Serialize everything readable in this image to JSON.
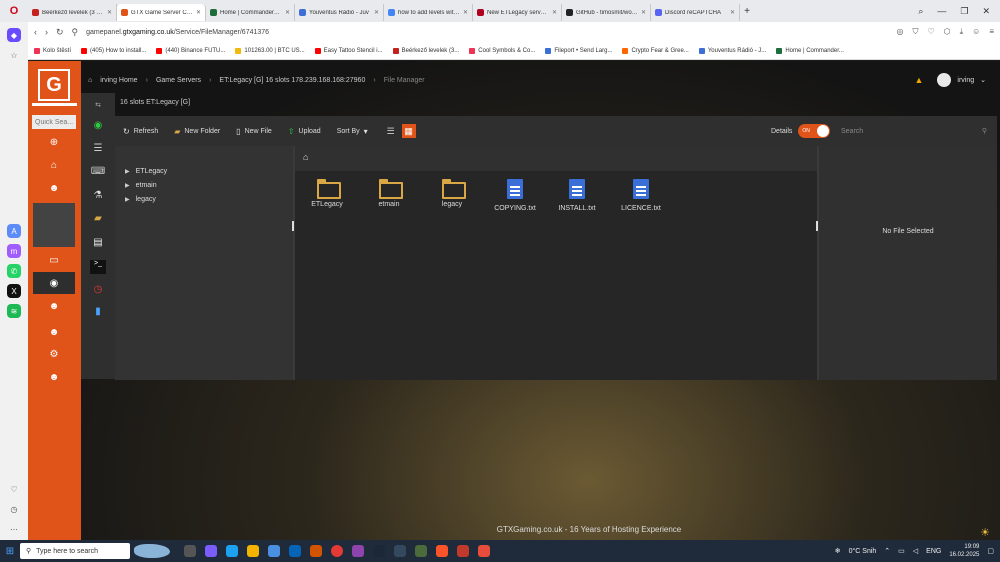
{
  "browser": {
    "tabs": [
      {
        "title": "Beérkező levelek (3 582)",
        "color": "#c5221f",
        "active": false
      },
      {
        "title": "GTX Game Server Control",
        "color": "#e0541a",
        "active": true
      },
      {
        "title": "Home | Commanders-arm",
        "color": "#1e6d3b",
        "active": false
      },
      {
        "title": "Youventus Rádió - Juv",
        "color": "#3d6fd6",
        "active": false
      },
      {
        "title": "how to add levels with rcon",
        "color": "#4285f4",
        "active": false
      },
      {
        "title": "New ETLegacy server set",
        "color": "#b00020",
        "active": false
      },
      {
        "title": "GitHub - timosmit/wolfadm",
        "color": "#222222",
        "active": false
      },
      {
        "title": "Discord reCAPTCHA",
        "color": "#5865f2",
        "active": false
      }
    ],
    "url_prefix": "gamepanel.",
    "url_domain": "gtxgaming.co.uk",
    "url_path": "/Service/FileManager/6741376",
    "bookmarks": [
      {
        "label": "Kolo štěstí",
        "color": "#e35"
      },
      {
        "label": "(405) How to install...",
        "color": "#f00"
      },
      {
        "label": "(440) Binance FUTU...",
        "color": "#f00"
      },
      {
        "label": "101263.00 | BTC US...",
        "color": "#f0b90b"
      },
      {
        "label": "Easy Tattoo Stencil i...",
        "color": "#f00"
      },
      {
        "label": "Beérkező levelek (3...",
        "color": "#c5221f"
      },
      {
        "label": "Cool Symbols & Co...",
        "color": "#e35"
      },
      {
        "label": "Fileport • Send Larg...",
        "color": "#3a6fd8"
      },
      {
        "label": "Crypto Fear & Gree...",
        "color": "#f60"
      },
      {
        "label": "Youventus Rádió - J...",
        "color": "#3d6fd6"
      },
      {
        "label": "Home | Commander...",
        "color": "#1e6d3b"
      }
    ]
  },
  "panel": {
    "quick_search_placeholder": "Quick Sea...",
    "breadcrumbs": {
      "home": "irving Home",
      "section": "Game Servers",
      "server": "ET:Legacy [G] 16 slots 178.239.168.168:27960",
      "current": "File Manager"
    },
    "server_name": "16 slots ET:Legacy [G]",
    "username": "irving",
    "toolbar": {
      "refresh": "Refresh",
      "new_folder": "New Folder",
      "new_file": "New File",
      "upload": "Upload",
      "sort_by": "Sort By",
      "details": "Details",
      "toggle_state": "ON",
      "search_placeholder": "Search"
    },
    "tree": [
      "ETLegacy",
      "etmain",
      "legacy"
    ],
    "files": [
      {
        "name": "ETLegacy",
        "type": "folder"
      },
      {
        "name": "etmain",
        "type": "folder"
      },
      {
        "name": "legacy",
        "type": "folder"
      },
      {
        "name": "COPYING.txt",
        "type": "file"
      },
      {
        "name": "INSTALL.txt",
        "type": "file"
      },
      {
        "name": "LICENCE.txt",
        "type": "file"
      }
    ],
    "no_selection": "No File Selected",
    "footer": "GTXGaming.co.uk - 16 Years of Hosting Experience",
    "accent_color": "#e0541a"
  },
  "taskbar": {
    "search_placeholder": "Type here to search",
    "weather": "0°C Snih",
    "language": "ENG",
    "time": "19:09",
    "date": "16.02.2025"
  }
}
